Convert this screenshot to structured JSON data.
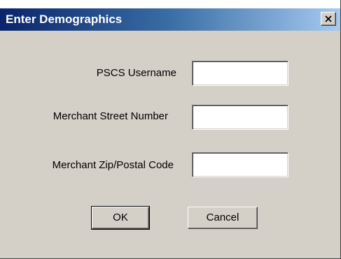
{
  "dialog": {
    "title": "Enter Demographics",
    "close_icon": "close-x-icon"
  },
  "fields": [
    {
      "label": "PSCS Username",
      "value": ""
    },
    {
      "label": "Merchant Street Number",
      "value": ""
    },
    {
      "label": "Merchant Zip/Postal Code",
      "value": ""
    }
  ],
  "buttons": {
    "ok_label": "OK",
    "cancel_label": "Cancel"
  },
  "colors": {
    "titlebar_start": "#0a246a",
    "titlebar_end": "#a6caf0",
    "face": "#d4d0c8"
  }
}
